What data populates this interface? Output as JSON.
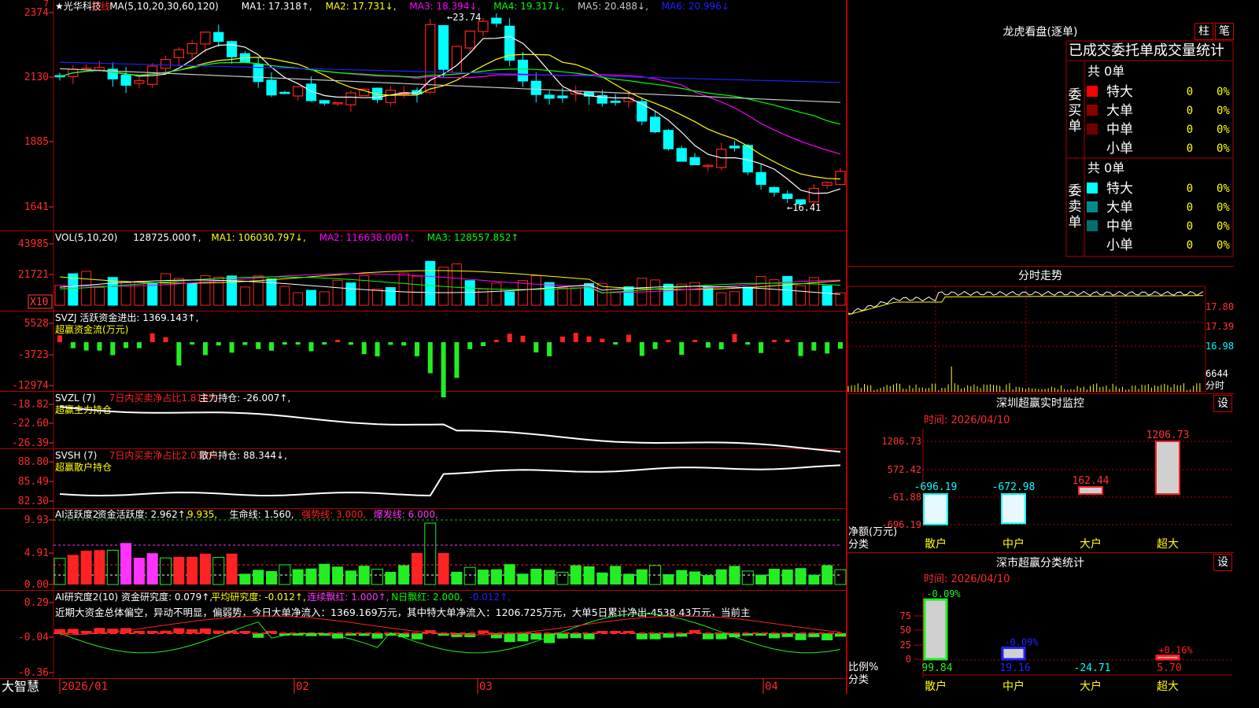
{
  "stock": {
    "name": "光华科技",
    "period": "日线"
  },
  "colors": {
    "up": "#ff2222",
    "down": "#00ffff",
    "grid": "#b00000",
    "axis": "#ff2a2a",
    "ma1": "#ffffff",
    "ma2": "#ffff00",
    "ma3": "#ff00ff",
    "ma4": "#00ff00",
    "ma5": "#c8c8c8",
    "ma6": "#2020ff",
    "green": "#22ee22",
    "magenta": "#ff33ff",
    "yellow": "#ffff00",
    "cyan": "#00ffff"
  },
  "main_chart": {
    "legend": [
      {
        "text": "★光华科技",
        "color": "#ffffff"
      },
      {
        "text": "日线",
        "color": "#ff2222"
      },
      {
        "text": "MA(5,10,20,30,60,120)",
        "color": "#ffffff"
      },
      {
        "text": "MA1: 17.318↑,",
        "color": "#ffffff"
      },
      {
        "text": "MA2: 17.731↓,",
        "color": "#ffff00"
      },
      {
        "text": "MA3: 18.394↓,",
        "color": "#ff00ff"
      },
      {
        "text": "MA4: 19.317↓,",
        "color": "#00ff00"
      },
      {
        "text": "MA5: 20.488↓,",
        "color": "#c8c8c8"
      },
      {
        "text": "MA6: 20.996↓",
        "color": "#2020ff"
      }
    ],
    "y_ticks": [
      "2374",
      "2130",
      "1885",
      "1641"
    ],
    "high_label": "23.74",
    "low_label": "16.41"
  },
  "vol_panel": {
    "legend": [
      {
        "text": "VOL(5,10,20)",
        "color": "#ffffff"
      },
      {
        "text": "128725.000↑,",
        "color": "#ffffff"
      },
      {
        "text": "MA1: 106030.797↓,",
        "color": "#ffff00"
      },
      {
        "text": "MA2: 116638.000↑,",
        "color": "#ff00ff"
      },
      {
        "text": "MA3: 128557.852↑",
        "color": "#00ff00"
      }
    ],
    "y_ticks": [
      "43985",
      "21721"
    ],
    "unit": "X10"
  },
  "svzj_panel": {
    "legend": [
      {
        "text": "SVZJ  活跃资金进出: 1369.143↑,",
        "color": "#ffffff"
      }
    ],
    "sub": "超赢资金流(万元)",
    "y_ticks": [
      "5528",
      "-3723",
      "-12974"
    ]
  },
  "svzl_panel": {
    "legend": [
      {
        "text": "SVZL (7)",
        "color": "#ffffff"
      },
      {
        "text": "7日内买卖净占比1.818%",
        "color": "#ff2222"
      },
      {
        "text": "主力持仓: -26.007↑,",
        "color": "#ffffff"
      }
    ],
    "sub": "超赢主力持仓",
    "y_ticks": [
      "-18.82",
      "-22.60",
      "-26.39"
    ]
  },
  "svsh_panel": {
    "legend": [
      {
        "text": "SVSH (7)",
        "color": "#ffffff"
      },
      {
        "text": "7日内买卖净占比2.033%",
        "color": "#ff2222"
      },
      {
        "text": "散户持仓: 88.344↓,",
        "color": "#ffffff"
      }
    ],
    "sub": "超赢散户持仓",
    "y_ticks": [
      "88.80",
      "85.49",
      "82.30"
    ]
  },
  "ai1_panel": {
    "legend": [
      {
        "text": "AI活跃度2",
        "color": "#ffffff"
      },
      {
        "text": "资金活跃度: 2.962↑,",
        "color": "#ffffff"
      },
      {
        "text": "9.935,",
        "color": "#ffff00"
      },
      {
        "text": "生命线: 1.560,",
        "color": "#ffffff"
      },
      {
        "text": "强势线: 3.000,",
        "color": "#ff2222"
      },
      {
        "text": "爆发线: 6.000,",
        "color": "#ff33ff"
      }
    ],
    "y_ticks": [
      "9.93",
      "4.91",
      "0.00"
    ]
  },
  "ai2_panel": {
    "legend": [
      {
        "text": "AI研究度2(10)",
        "color": "#ffffff"
      },
      {
        "text": "资金研究度: 0.079↑,",
        "color": "#ffffff"
      },
      {
        "text": "平均研究度: -0.012↑,",
        "color": "#ffff00"
      },
      {
        "text": "连续飘红: 1.000↑,",
        "color": "#ff33ff"
      },
      {
        "text": "N日飘红: 2.000,",
        "color": "#00ff00"
      },
      {
        "text": "-0.012↑,",
        "color": "#2020ff"
      }
    ],
    "comment": "近期大资金总体偏空，异动不明显，偏弱势，今日大单净流入：1369.169万元，其中特大单净流入：1206.725万元，大单5日累计净出-4538.43万元，当前主",
    "y_ticks": [
      "0.29",
      "-0.04",
      "-0.36"
    ]
  },
  "x_axis": {
    "labels": [
      "2026/01",
      "02",
      "03",
      "04"
    ]
  },
  "brand": "大智慧",
  "dragon": {
    "title": "龙虎看盘(逐单)",
    "btn_zhu": "柱",
    "btn_bi": "笔",
    "header": "已成交委托单成交量统计",
    "buy_label": "委买单",
    "sell_label": "委卖单",
    "buy": {
      "total": "共 0单",
      "rows": [
        {
          "name": "特大",
          "count": "0",
          "pct": "0%",
          "color": "#ff0000"
        },
        {
          "name": "大单",
          "count": "0",
          "pct": "0%",
          "color": "#8b0000"
        },
        {
          "name": "中单",
          "count": "0",
          "pct": "0%",
          "color": "#6e0000"
        },
        {
          "name": "小单",
          "count": "0",
          "pct": "0%",
          "color": ""
        }
      ]
    },
    "sell": {
      "total": "共 0单",
      "rows": [
        {
          "name": "特大",
          "count": "0",
          "pct": "0%",
          "color": "#00ffff"
        },
        {
          "name": "大单",
          "count": "0",
          "pct": "0%",
          "color": "#008b8b"
        },
        {
          "name": "中单",
          "count": "0",
          "pct": "0%",
          "color": "#007070"
        },
        {
          "name": "小单",
          "count": "0",
          "pct": "0%",
          "color": ""
        }
      ]
    }
  },
  "intraday": {
    "title": "分时走势",
    "y_ticks": [
      "17.80",
      "17.39",
      "16.98",
      "6644"
    ],
    "unit": "分时"
  },
  "monitor": {
    "title": "深圳超赢实时监控",
    "btn": "设",
    "time": "时间: 2026/04/10",
    "y_ticks": [
      "1206.73",
      "572.42",
      "-61.88",
      "-696.19"
    ],
    "ylabel": "净额(万元)",
    "xlabel": "分类",
    "cats": [
      "散户",
      "中户",
      "大户",
      "超大"
    ],
    "values": [
      -696.19,
      -672.98,
      162.44,
      1206.73
    ],
    "value_labels": [
      "-696.19",
      "-672.98",
      "162.44",
      "1206.73"
    ]
  },
  "classify": {
    "title": "深市超赢分类统计",
    "btn": "设",
    "time": "时间: 2026/04/10",
    "y_ticks": [
      "75",
      "50",
      "25",
      "0"
    ],
    "ylabel": "比例%",
    "xlabel": "分类",
    "cats": [
      "散户",
      "中户",
      "大户",
      "超大"
    ],
    "values": [
      99.84,
      19.16,
      -24.71,
      5.7
    ],
    "bottom_labels": [
      "99.84",
      "19.16",
      "-24.71",
      "5.70"
    ],
    "top_labels": [
      "-0.09%",
      "-0.09%",
      "",
      "+0.16%"
    ]
  },
  "chart_data": [
    {
      "type": "candlestick",
      "title": "光华科技 日线",
      "ylim": [
        16.41,
        23.74
      ],
      "x": [
        "2026/01",
        "02",
        "03",
        "04"
      ],
      "series": [
        {
          "name": "K",
          "values": [
            21.4,
            21.7,
            21.9,
            21.8,
            20.9,
            21.3,
            21.6,
            22.0,
            22.5,
            22.8,
            23.1,
            22.4,
            22.2,
            21.5,
            20.6,
            20.9,
            21.0,
            20.3,
            20.6,
            20.5,
            20.8,
            20.6,
            20.9,
            20.6,
            20.9,
            21.1,
            22.1,
            23.0,
            23.7,
            23.4,
            22.0,
            21.2,
            20.5,
            20.7,
            20.7,
            20.8,
            20.4,
            20.6,
            20.4,
            19.6,
            18.9,
            18.4,
            18.0,
            17.9,
            18.5,
            18.6,
            17.7,
            17.2,
            16.8,
            16.9,
            17.1,
            17.2,
            17.7
          ]
        },
        {
          "name": "MA1",
          "values": []
        },
        {
          "name": "MA2",
          "values": []
        }
      ]
    },
    {
      "type": "bar",
      "title": "VOL(5,10,20)",
      "ylim": [
        0,
        43985
      ]
    },
    {
      "type": "bar",
      "title": "SVZJ 活跃资金进出",
      "ylim": [
        -12974,
        5528
      ]
    },
    {
      "type": "line",
      "title": "SVZL 主力持仓",
      "ylim": [
        -26.39,
        -18.82
      ]
    },
    {
      "type": "line",
      "title": "SVSH 散户持仓",
      "ylim": [
        82.3,
        88.8
      ]
    },
    {
      "type": "bar",
      "title": "AI活跃度2",
      "ylim": [
        0,
        9.93
      ]
    },
    {
      "type": "bar",
      "title": "AI研究度2(10)",
      "ylim": [
        -0.36,
        0.29
      ]
    },
    {
      "type": "bar",
      "title": "深圳超赢实时监控",
      "categories": [
        "散户",
        "中户",
        "大户",
        "超大"
      ],
      "values": [
        -696.19,
        -672.98,
        162.44,
        1206.73
      ],
      "ylim": [
        -696.19,
        1206.73
      ]
    },
    {
      "type": "bar",
      "title": "深市超赢分类统计",
      "categories": [
        "散户",
        "中户",
        "大户",
        "超大"
      ],
      "values": [
        99.84,
        19.16,
        -24.71,
        5.7
      ],
      "ylim": [
        0,
        100
      ]
    }
  ]
}
